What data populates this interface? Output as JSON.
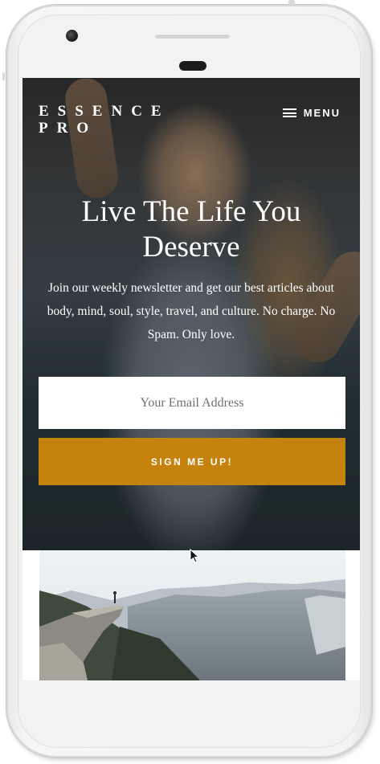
{
  "site": {
    "logo_line1": "ESSENCE",
    "logo_line2": "PRO",
    "menu_label": "MENU",
    "menu_icon": "hamburger-icon"
  },
  "hero": {
    "headline_line1": "Live The Life You",
    "headline_line2": "Deserve",
    "subtext": "Join our weekly newsletter and get our best articles about body, mind, soul, style, travel, and culture. No charge. No Spam. Only love."
  },
  "signup": {
    "email_placeholder": "Your Email Address",
    "email_value": "",
    "button_label": "SIGN ME UP!"
  },
  "featured": {
    "image": "mountain-cliff-landscape"
  },
  "colors": {
    "accent": "#c5830d",
    "hero_overlay": "#000000",
    "text_on_hero": "#ffffff"
  }
}
